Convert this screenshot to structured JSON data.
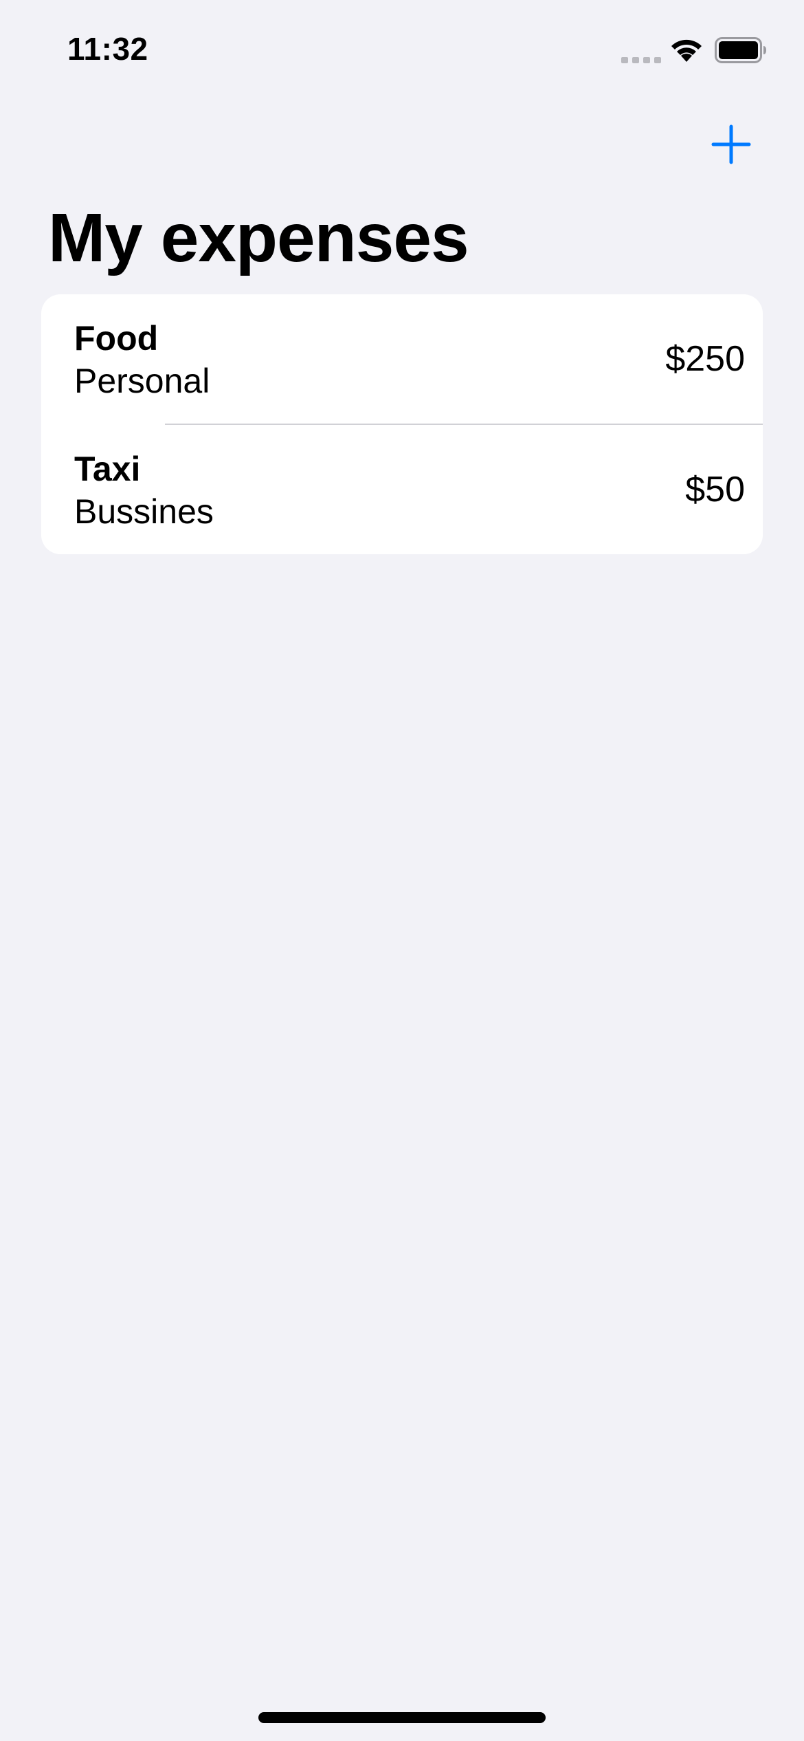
{
  "status_bar": {
    "time": "11:32"
  },
  "nav": {
    "add_icon": "plus-icon",
    "accent_color": "#007aff"
  },
  "page": {
    "title": "My expenses"
  },
  "expenses": [
    {
      "name": "Food",
      "category": "Personal",
      "amount": "$250"
    },
    {
      "name": "Taxi",
      "category": "Bussines",
      "amount": "$50"
    }
  ]
}
